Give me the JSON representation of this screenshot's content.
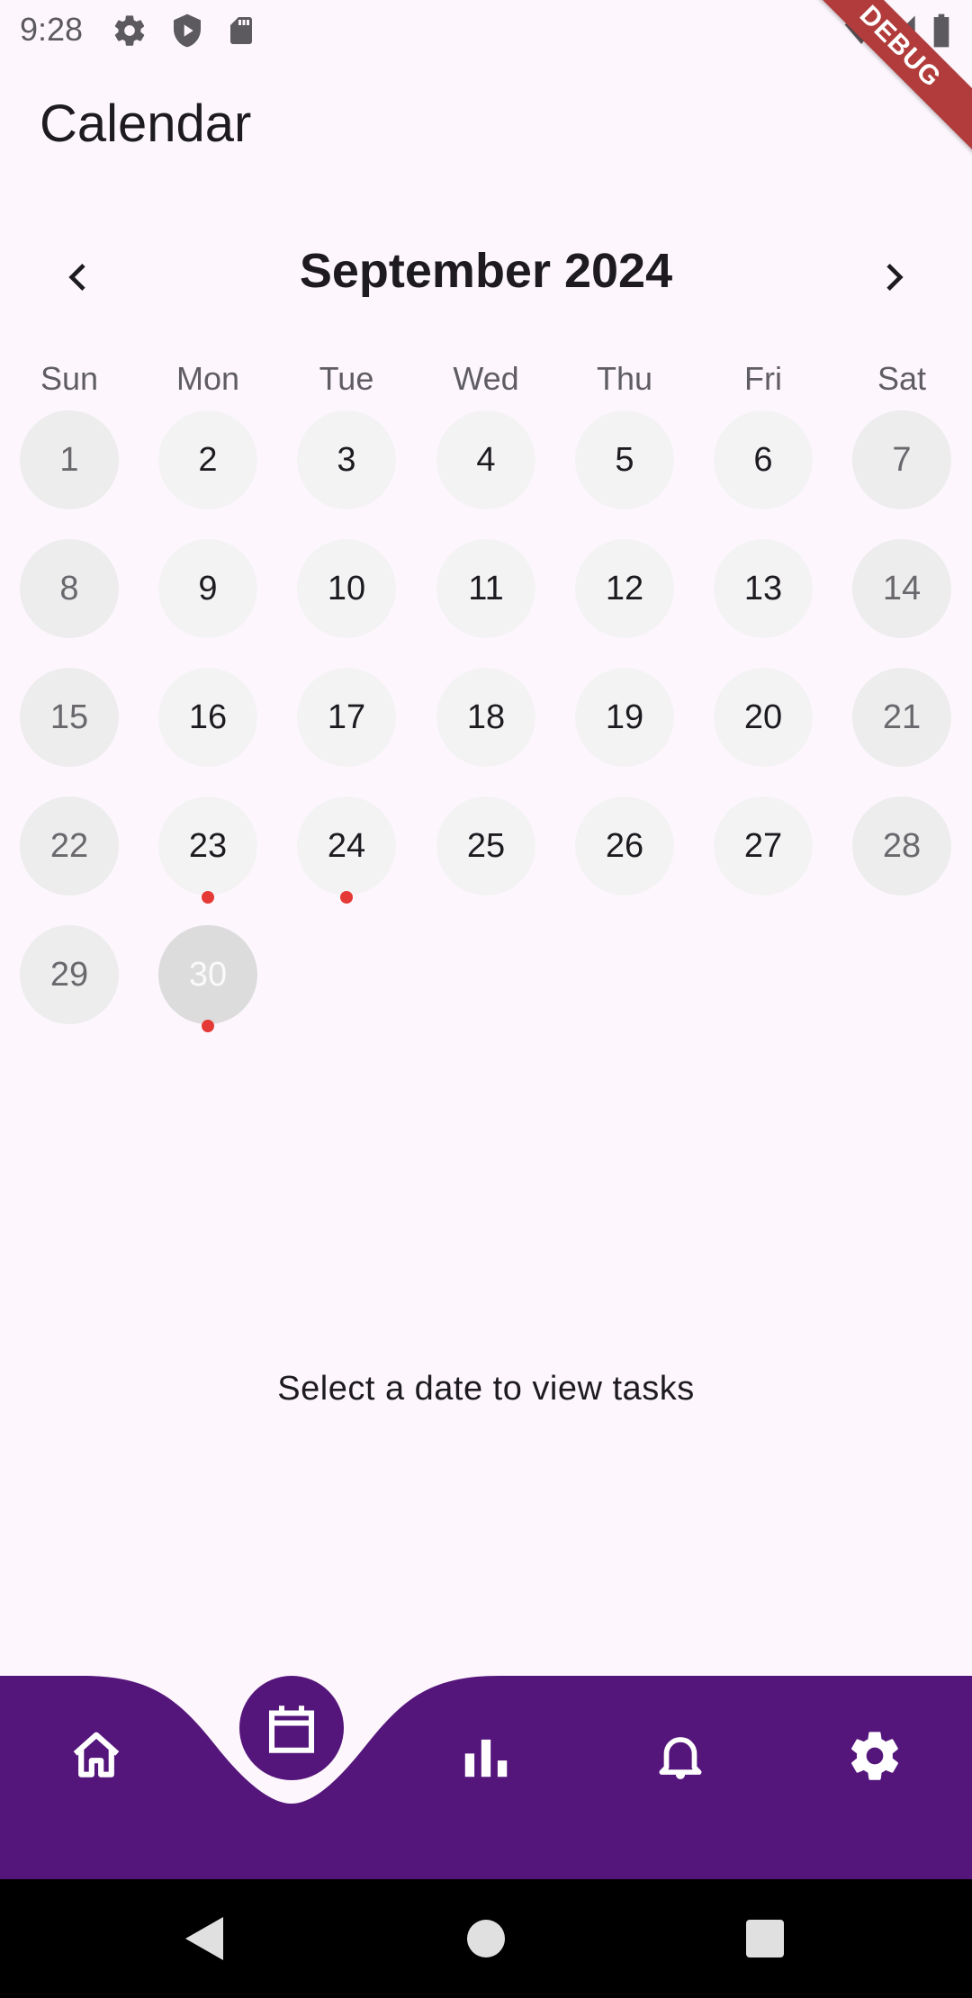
{
  "status_bar": {
    "time": "9:28",
    "icons": [
      "settings-icon",
      "shield-icon",
      "sd-card-icon",
      "wifi-icon",
      "signal-icon",
      "battery-icon"
    ],
    "debug_label": "DEBUG"
  },
  "app_bar": {
    "title": "Calendar"
  },
  "calendar": {
    "month_label": "September 2024",
    "prev_icon": "chevron-left-icon",
    "next_icon": "chevron-right-icon",
    "weekdays": [
      "Sun",
      "Mon",
      "Tue",
      "Wed",
      "Thu",
      "Fri",
      "Sat"
    ],
    "days": [
      {
        "label": "1",
        "weekend": true
      },
      {
        "label": "2"
      },
      {
        "label": "3"
      },
      {
        "label": "4"
      },
      {
        "label": "5"
      },
      {
        "label": "6"
      },
      {
        "label": "7",
        "weekend": true
      },
      {
        "label": "8",
        "weekend": true
      },
      {
        "label": "9"
      },
      {
        "label": "10"
      },
      {
        "label": "11"
      },
      {
        "label": "12"
      },
      {
        "label": "13"
      },
      {
        "label": "14",
        "weekend": true
      },
      {
        "label": "15",
        "weekend": true
      },
      {
        "label": "16"
      },
      {
        "label": "17"
      },
      {
        "label": "18"
      },
      {
        "label": "19"
      },
      {
        "label": "20"
      },
      {
        "label": "21",
        "weekend": true
      },
      {
        "label": "22",
        "weekend": true
      },
      {
        "label": "23",
        "has_task": true
      },
      {
        "label": "24",
        "has_task": true
      },
      {
        "label": "25"
      },
      {
        "label": "26"
      },
      {
        "label": "27"
      },
      {
        "label": "28",
        "weekend": true
      },
      {
        "label": "29",
        "weekend": true
      },
      {
        "label": "30",
        "has_task": true,
        "today": true
      }
    ]
  },
  "empty_state": {
    "message": "Select a date to view tasks"
  },
  "bottom_nav": {
    "items": [
      {
        "icon": "home-icon",
        "active": false
      },
      {
        "icon": "calendar-icon",
        "active": true
      },
      {
        "icon": "bar-chart-icon",
        "active": false
      },
      {
        "icon": "bell-icon",
        "active": false
      },
      {
        "icon": "settings-icon",
        "active": false
      }
    ]
  },
  "system_nav": {
    "icons": [
      "back-icon",
      "home-circle-icon",
      "recents-icon"
    ]
  },
  "colors": {
    "accent": "#55167c",
    "task_dot": "#e53935",
    "background": "#fdf7fd",
    "day_bg": "#f4f3f4",
    "weekend_bg": "#ededed",
    "today_bg": "#dcdcdc"
  }
}
